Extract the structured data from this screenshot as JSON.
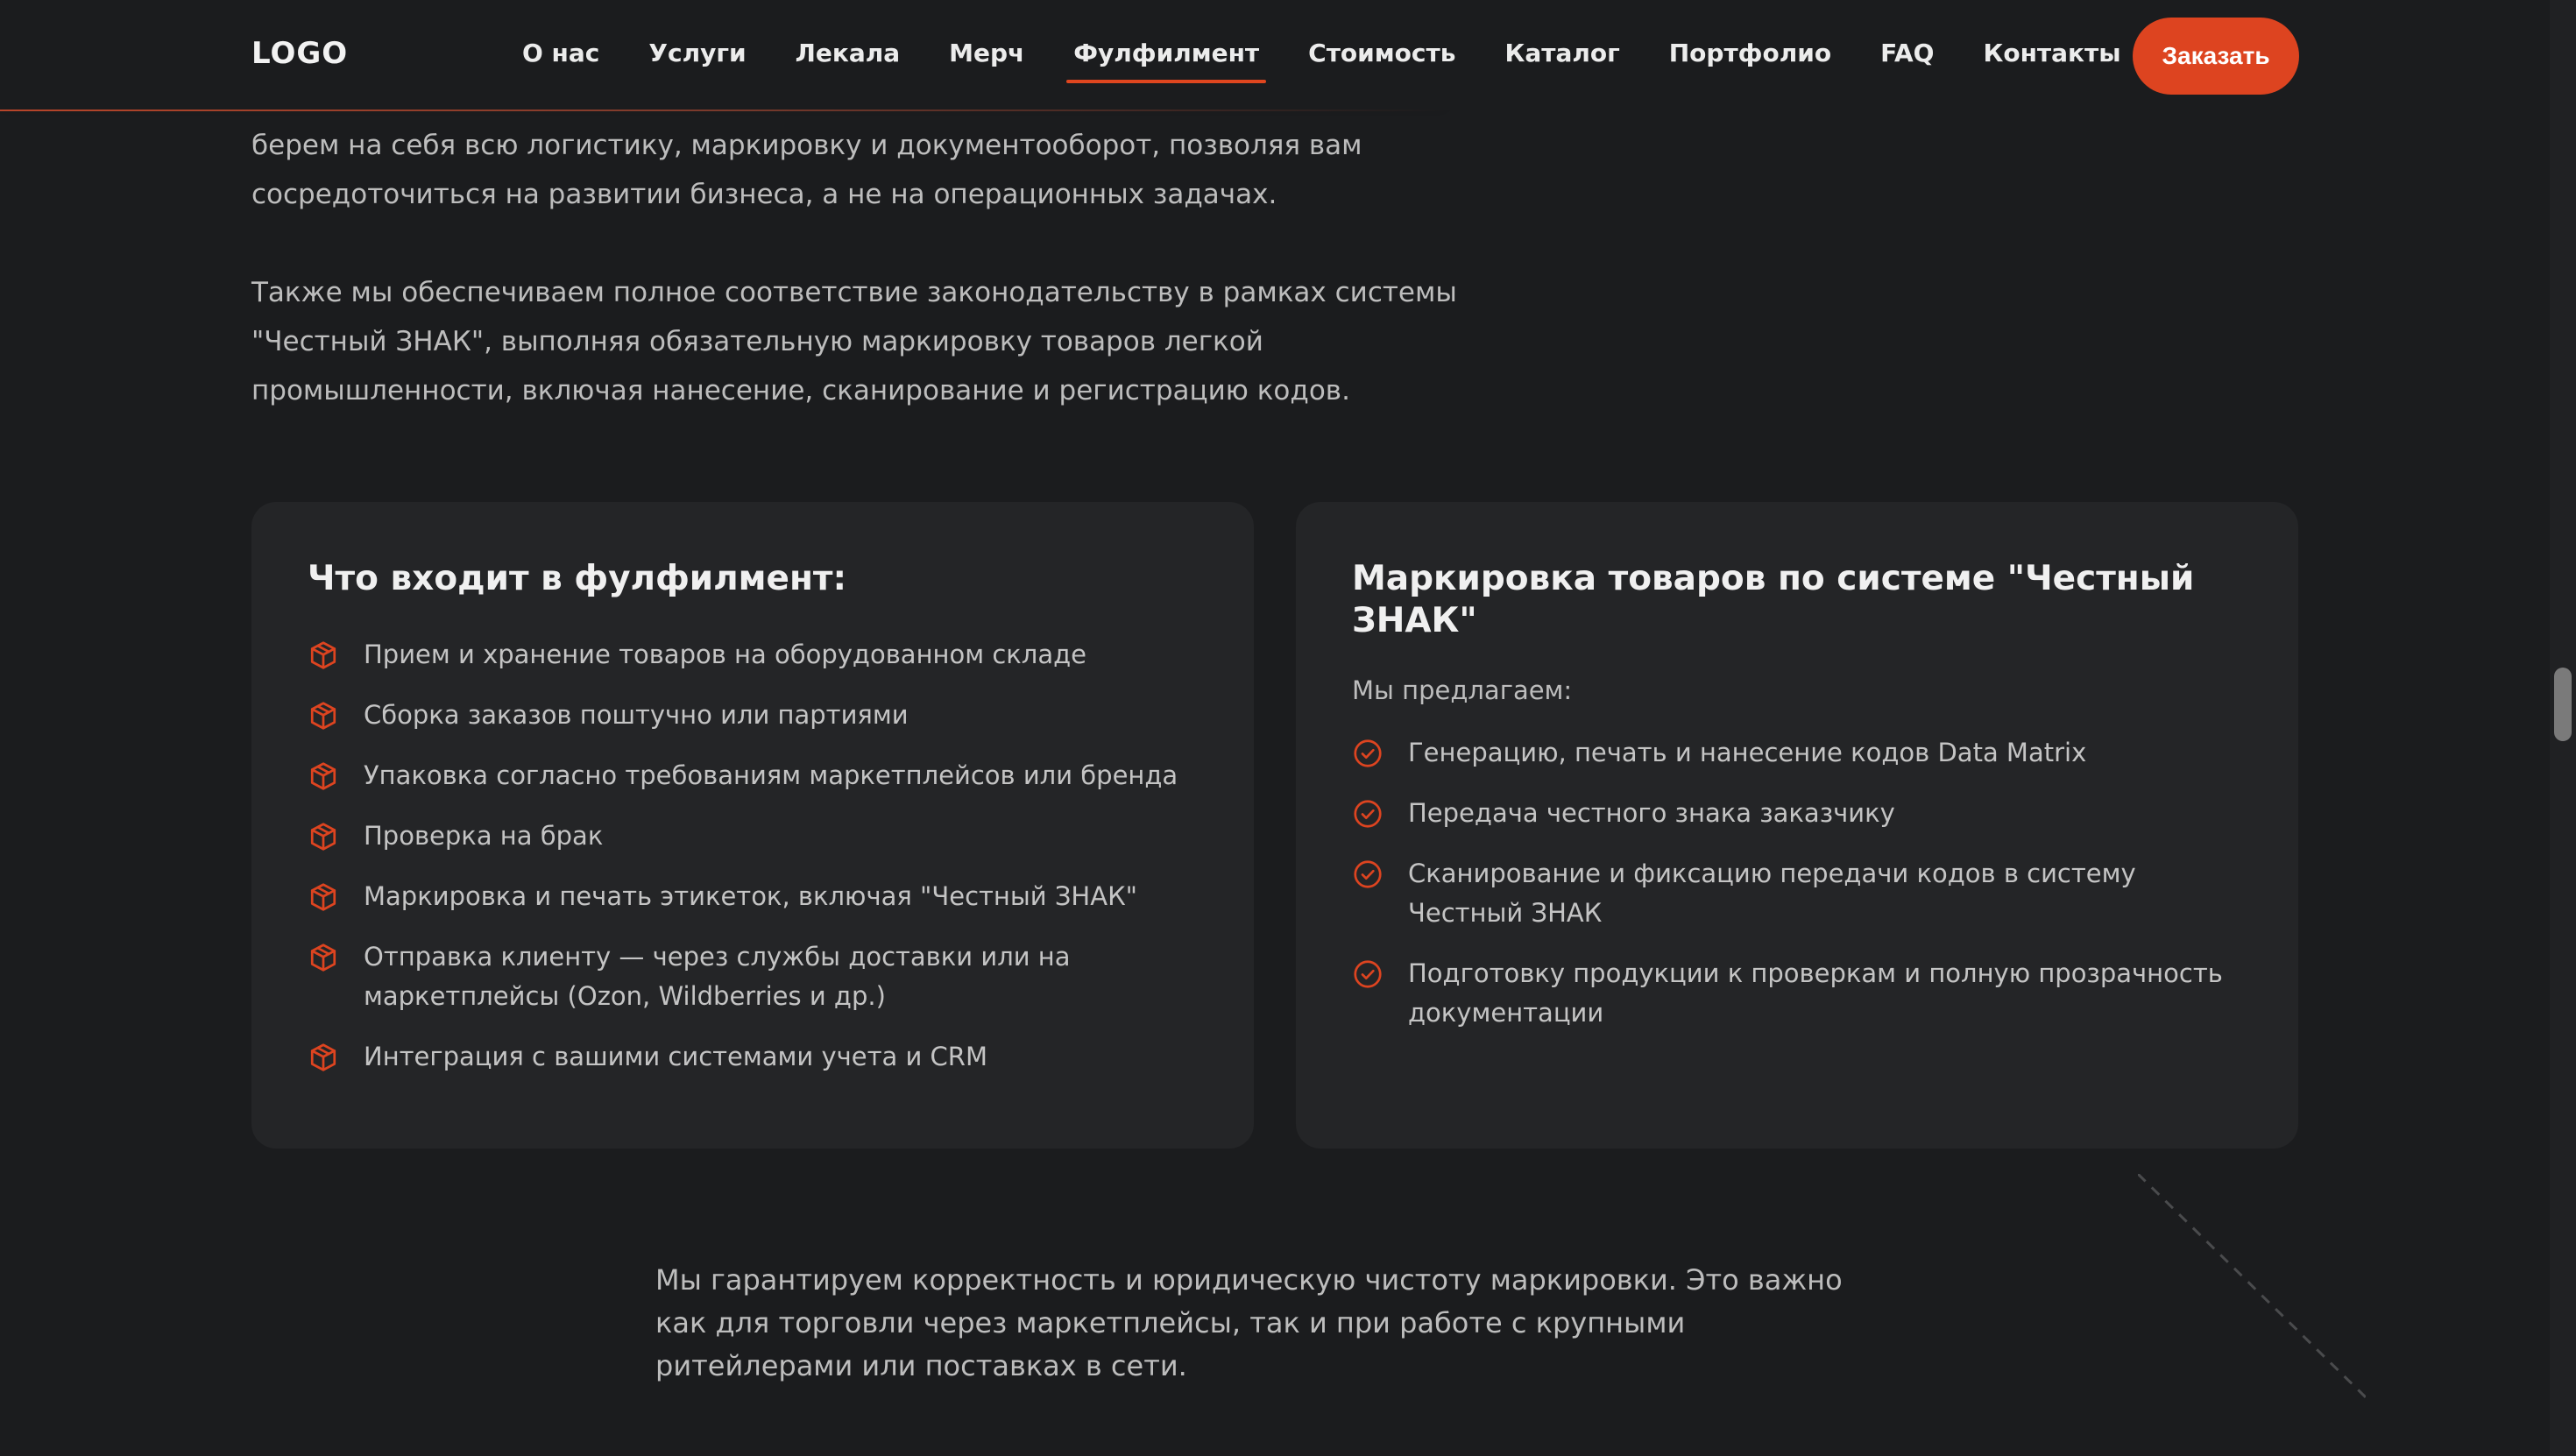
{
  "header": {
    "logo": "LOGO",
    "nav": [
      {
        "label": "О нас",
        "active": false
      },
      {
        "label": "Услуги",
        "active": false
      },
      {
        "label": "Лекала",
        "active": false
      },
      {
        "label": "Мерч",
        "active": false
      },
      {
        "label": "Фулфилмент",
        "active": true
      },
      {
        "label": "Стоимость",
        "active": false
      },
      {
        "label": "Каталог",
        "active": false
      },
      {
        "label": "Портфолио",
        "active": false
      },
      {
        "label": "FAQ",
        "active": false
      },
      {
        "label": "Контакты",
        "active": false
      }
    ],
    "order_button": "Заказать"
  },
  "intro": {
    "paragraph1_line_partial": "берем на себя всю логистику, маркировку и документооборот, позволяя вам сосредоточиться на развитии бизнеса, а не на операционных задачах.",
    "paragraph2": "Также мы обеспечиваем полное соответствие законодательству в рамках системы \"Честный ЗНАК\", выполняя обязательную маркировку товаров легкой промышленности, включая нанесение, сканирование и регистрацию кодов."
  },
  "fulfillment_card": {
    "title": "Что входит в фулфилмент:",
    "icon": "package-icon",
    "items": [
      "Прием и хранение товаров на оборудованном складе",
      "Сборка заказов поштучно или партиями",
      "Упаковка согласно требованиям маркетплейсов или бренда",
      "Проверка на брак",
      "Маркировка и печать этикеток, включая \"Честный ЗНАК\"",
      "Отправка клиенту — через службы доставки или на маркетплейсы (Ozon, Wildberries и др.)",
      "Интеграция с вашими системами учета и CRM"
    ]
  },
  "marking_card": {
    "title": "Маркировка товаров по системе \"Честный ЗНАК\"",
    "subtitle": "Мы предлагаем:",
    "icon": "check-circle-icon",
    "items": [
      "Генерацию, печать и нанесение кодов Data Matrix",
      "Передача честного знака заказчику",
      "Сканирование и фиксацию передачи кодов в систему Честный ЗНАК",
      "Подготовку продукции к проверкам и полную прозрачность документации"
    ]
  },
  "bottom": {
    "text": "Мы гарантируем корректность и юридическую чистоту маркировки. Это важно как для торговли через маркетплейсы, так и при работе с крупными ритейлерами или поставках в сети."
  },
  "colors": {
    "background": "#1b1c1e",
    "card": "#242527",
    "accent": "#dd4420",
    "text": "#bdbdbd",
    "heading": "#f0f0f0"
  }
}
